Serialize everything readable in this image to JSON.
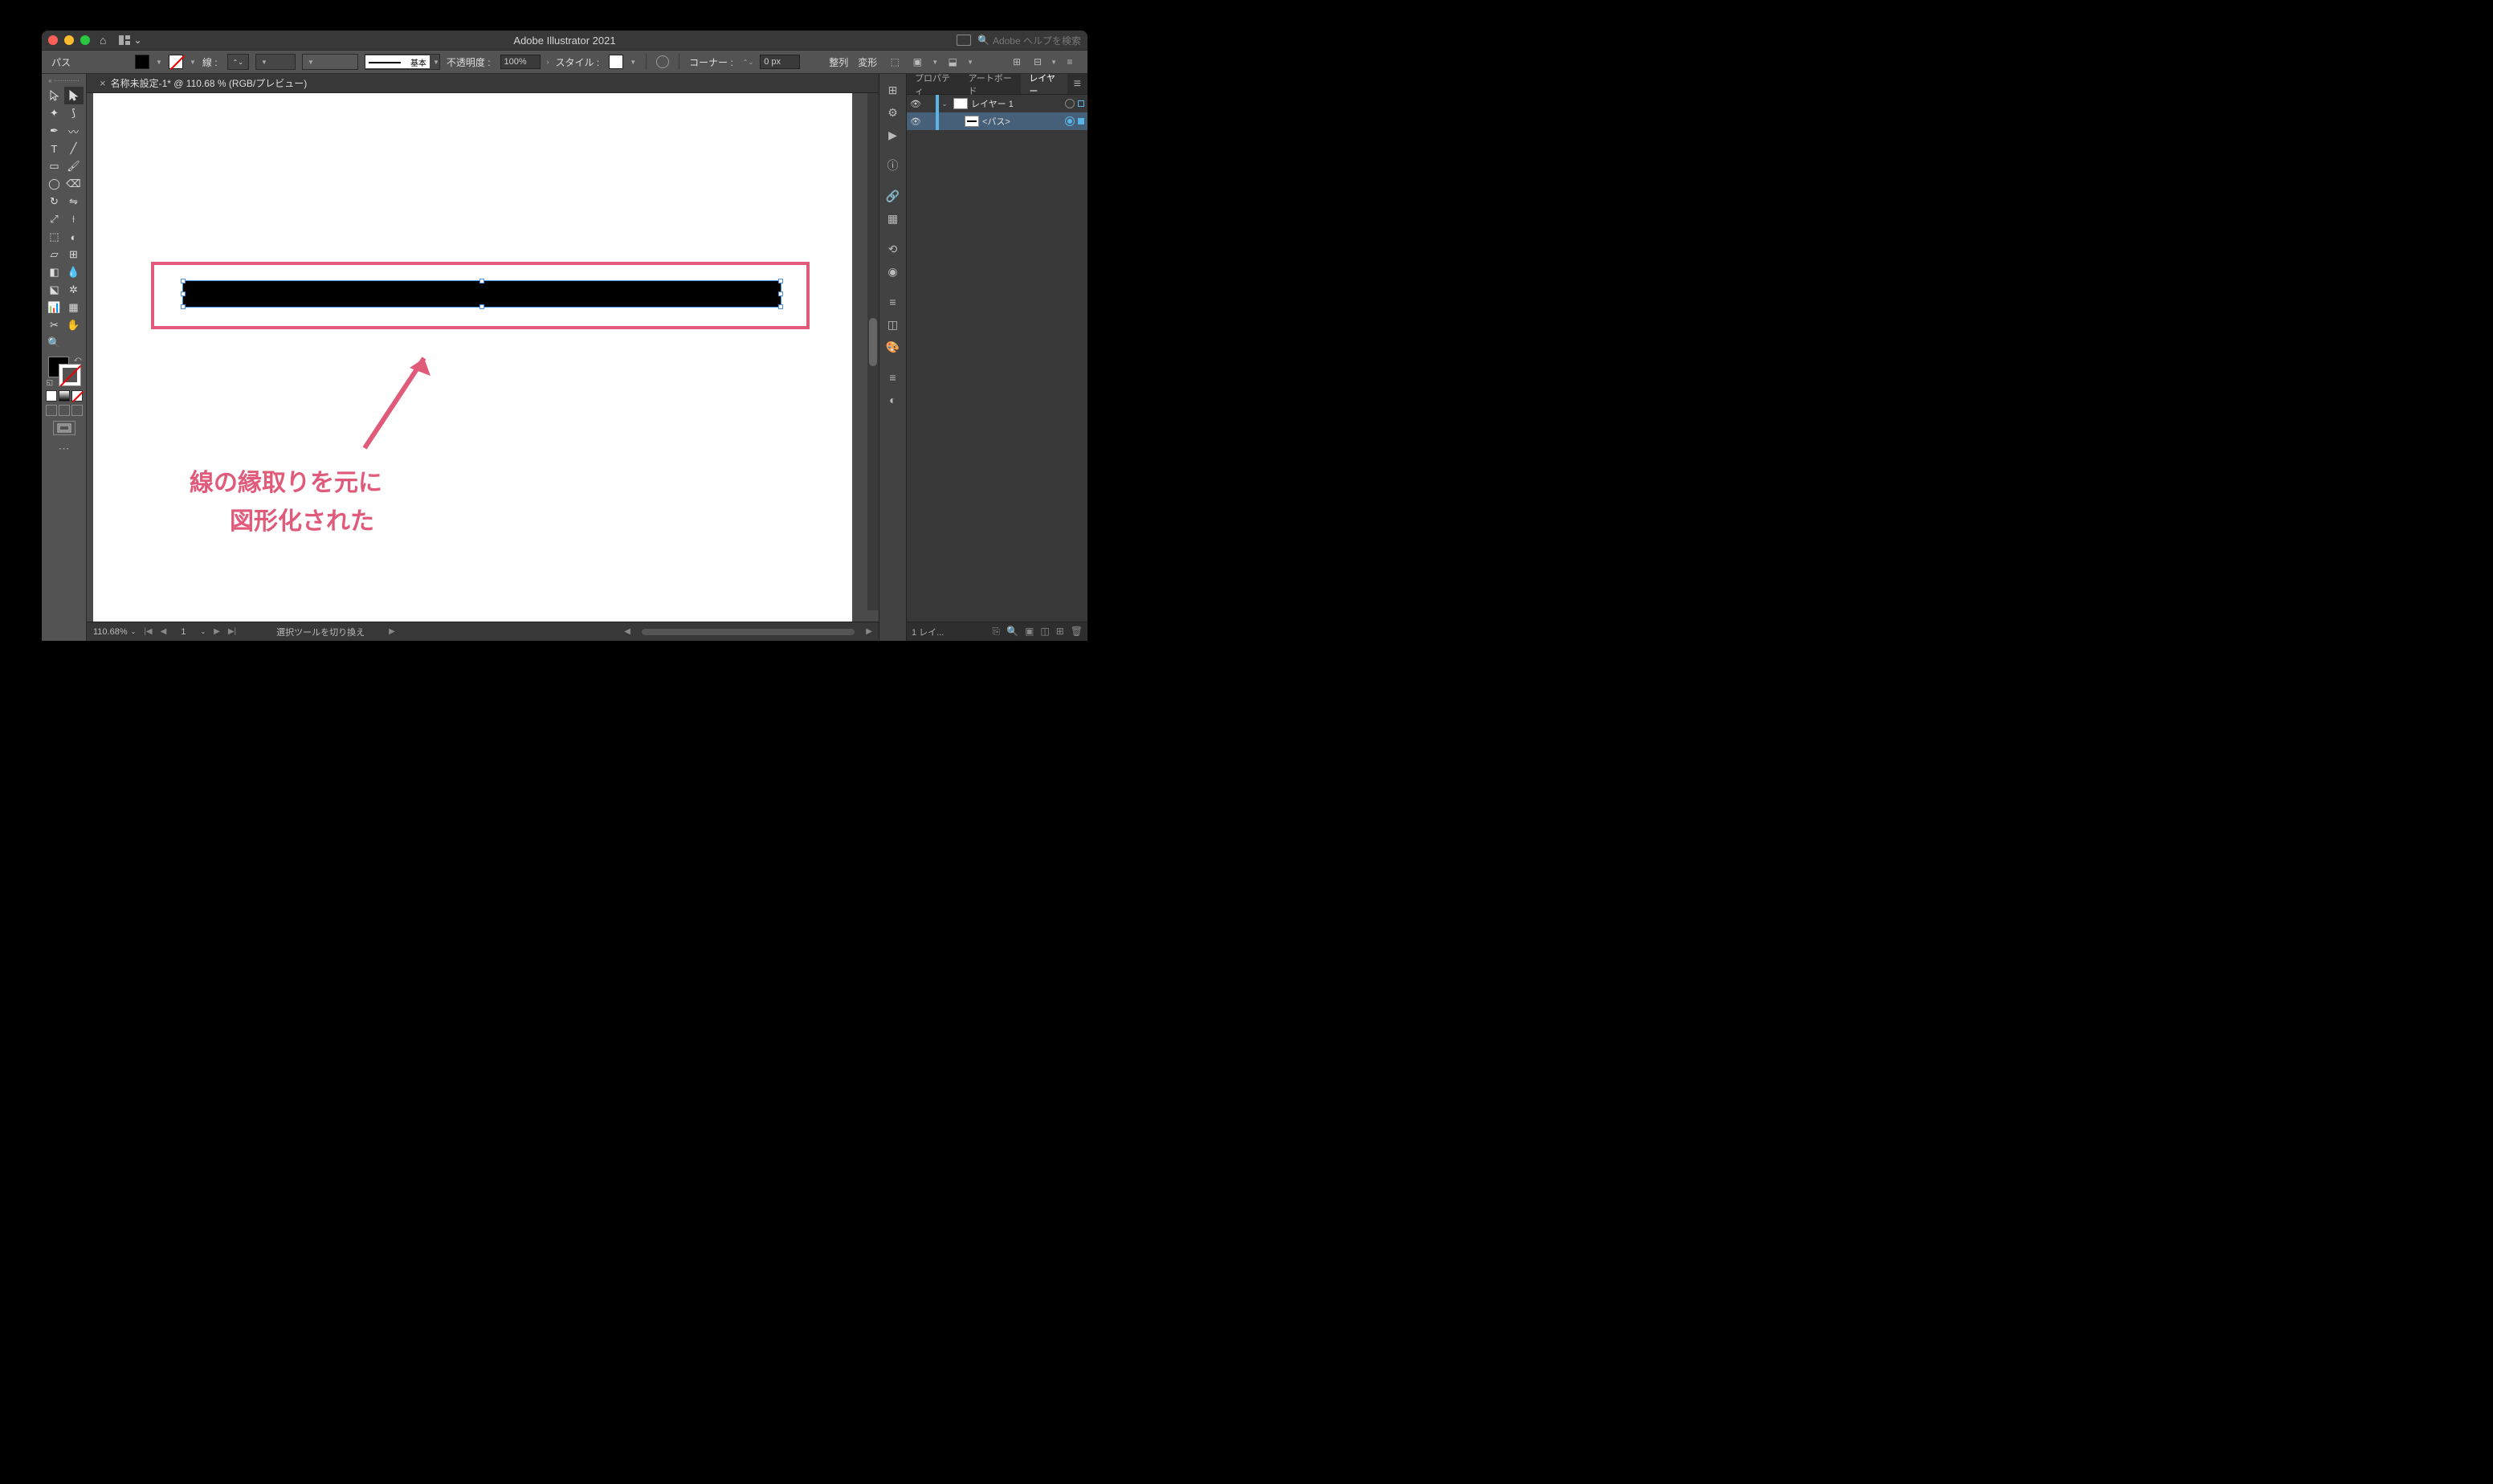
{
  "title": "Adobe Illustrator 2021",
  "search_placeholder": "Adobe ヘルプを検索",
  "controlbar": {
    "selection_label": "パス",
    "stroke_label": "線 :",
    "stroke_weight": "",
    "profile_label": "基本",
    "opacity_label": "不透明度 :",
    "opacity_value": "100%",
    "style_label": "スタイル :",
    "corner_label": "コーナー :",
    "corner_value": "0 px",
    "align_label": "整列",
    "transform_label": "変形"
  },
  "document": {
    "tab_title": "名称未設定-1* @ 110.68 % (RGB/プレビュー)"
  },
  "annotation": {
    "line1": "線の縁取りを元に",
    "line2": "図形化された"
  },
  "status": {
    "zoom": "110.68%",
    "artboard": "1",
    "tool_hint": "選択ツールを切り換え"
  },
  "panels": {
    "tabs": {
      "properties": "プロパティ",
      "artboards": "アートボード",
      "layers": "レイヤー"
    },
    "layer1_name": "レイヤー 1",
    "path_name": "<パス>",
    "footer_count": "1 レイ..."
  }
}
